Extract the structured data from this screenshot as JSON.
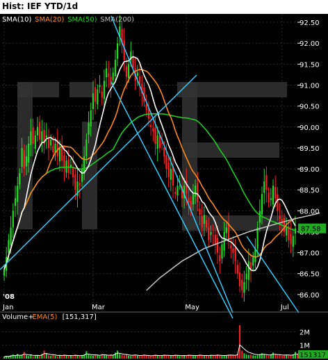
{
  "title": "Hist: IEF YTD/1d",
  "chart_data": [
    {
      "type": "candlestick",
      "legend": [
        {
          "label": "SMA(10)",
          "color": "#ffffff"
        },
        {
          "label": "SMA(20)",
          "color": "#ff8a1e"
        },
        {
          "label": "SMA(50)",
          "color": "#22cc22"
        },
        {
          "label": "SMA(200)",
          "color": "#c0c0c0"
        }
      ],
      "ylim": [
        85.6,
        92.7
      ],
      "yticks": [
        92.5,
        92.0,
        91.5,
        91.0,
        90.5,
        90.0,
        89.5,
        89.0,
        88.5,
        88.0,
        87.5,
        87.0,
        86.5,
        86.0
      ],
      "ytick_labels": [
        "92.50",
        "92.00",
        "91.50",
        "91.00",
        "90.50",
        "90.00",
        "89.50",
        "89.00",
        "88.50",
        "88.00",
        "87.50",
        "87.00",
        "86.50",
        "86.00"
      ],
      "xticks": [
        {
          "day": 0,
          "label": "Jan"
        },
        {
          "day": 40,
          "label": "Mar"
        },
        {
          "day": 82,
          "label": "May"
        },
        {
          "day": 125,
          "label": "Jul"
        }
      ],
      "year_label": "'08",
      "last_price": "87.58",
      "up_color": "#22dd22",
      "down_color": "#ff2020",
      "sma10_color": "#ffffff",
      "sma20_color": "#ff8a1e",
      "sma50_color": "#22cc22",
      "sma200_color": "#c0c0c0",
      "trendline_color": "#33ccff",
      "closes": [
        86.6,
        86.9,
        87.3,
        87.6,
        88.0,
        88.3,
        88.6,
        88.9,
        89.5,
        89.0,
        89.3,
        89.6,
        89.9,
        89.6,
        89.8,
        90.0,
        89.7,
        89.9,
        89.6,
        89.8,
        89.5,
        89.7,
        89.4,
        89.6,
        89.3,
        89.5,
        89.2,
        89.0,
        89.2,
        88.9,
        89.1,
        88.8,
        88.5,
        88.7,
        88.6,
        89.0,
        89.3,
        89.7,
        90.1,
        90.4,
        90.8,
        90.6,
        90.9,
        91.0,
        90.7,
        91.1,
        91.4,
        91.2,
        91.0,
        91.3,
        91.6,
        92.0,
        92.4,
        92.0,
        91.6,
        91.2,
        91.5,
        91.8,
        91.4,
        91.1,
        91.3,
        91.0,
        90.8,
        90.6,
        90.4,
        90.2,
        90.0,
        89.9,
        89.6,
        89.8,
        89.5,
        89.6,
        89.3,
        89.0,
        88.8,
        89.0,
        88.6,
        88.4,
        88.6,
        88.7,
        88.3,
        88.6,
        88.4,
        88.2,
        88.0,
        88.4,
        88.6,
        88.2,
        87.9,
        87.6,
        87.9,
        87.6,
        87.3,
        87.5,
        87.4,
        87.2,
        87.0,
        86.8,
        87.2,
        87.5,
        87.6,
        87.3,
        87.1,
        87.0,
        86.8,
        86.5,
        86.2,
        86.1,
        86.3,
        86.5,
        86.8,
        86.6,
        86.9,
        87.1,
        87.6,
        88.0,
        88.4,
        88.7,
        88.5,
        88.2,
        88.3,
        88.6,
        88.3,
        88.0,
        87.8,
        87.7,
        87.5,
        87.6,
        87.3,
        87.2,
        87.4,
        87.58
      ],
      "sma200": [
        [
          64,
          86.1
        ],
        [
          70,
          86.4
        ],
        [
          80,
          86.8
        ],
        [
          90,
          87.1
        ],
        [
          100,
          87.3
        ],
        [
          110,
          87.5
        ],
        [
          120,
          87.65
        ],
        [
          130,
          87.8
        ],
        [
          140,
          87.92
        ],
        [
          142,
          87.95
        ]
      ],
      "volume": {
        "label": "Volume",
        "ema_label": "EMA(5)",
        "value_label": "[151,317]",
        "last_label": "151317",
        "ylim": [
          0,
          2.7
        ],
        "yticks": [
          {
            "v": 2,
            "label": "2M"
          },
          {
            "v": 1,
            "label": "1M"
          }
        ],
        "bars": [
          0.15,
          0.2,
          0.18,
          0.25,
          0.3,
          0.2,
          0.35,
          0.22,
          0.28,
          0.5,
          0.25,
          0.2,
          0.3,
          0.18,
          0.22,
          0.25,
          0.2,
          0.35,
          0.6,
          0.4,
          0.25,
          0.2,
          0.3,
          0.22,
          0.18,
          0.25,
          0.2,
          0.3,
          0.22,
          0.2,
          0.25,
          0.18,
          0.3,
          0.22,
          0.2,
          0.25,
          0.3,
          0.55,
          0.3,
          0.25,
          0.22,
          0.3,
          0.25,
          0.2,
          0.35,
          0.3,
          0.25,
          0.2,
          0.3,
          0.25,
          0.45,
          0.6,
          0.35,
          0.28,
          0.25,
          0.3,
          0.22,
          0.2,
          0.25,
          0.3,
          0.22,
          0.2,
          0.25,
          0.3,
          0.22,
          0.2,
          0.18,
          0.25,
          0.3,
          0.22,
          0.2,
          0.25,
          0.3,
          0.22,
          0.25,
          0.2,
          0.22,
          0.3,
          0.25,
          0.2,
          0.22,
          0.25,
          0.2,
          0.3,
          0.25,
          0.22,
          0.2,
          0.25,
          0.3,
          0.22,
          0.2,
          0.25,
          0.2,
          0.28,
          0.25,
          0.22,
          0.3,
          0.25,
          0.2,
          0.22,
          0.25,
          0.3,
          0.28,
          0.25,
          0.22,
          0.35,
          2.5,
          0.6,
          0.4,
          0.3,
          0.28,
          0.3,
          0.25,
          0.22,
          0.25,
          0.3,
          0.4,
          0.3,
          0.25,
          0.22,
          0.3,
          0.45,
          0.3,
          0.25,
          0.3,
          0.22,
          0.25,
          0.3,
          0.25,
          0.22,
          0.3,
          0.5,
          0.3,
          0.25,
          0.22,
          0.3,
          0.25,
          0.22,
          0.2,
          0.25,
          0.25,
          0.2,
          0.3,
          0.15
        ]
      }
    }
  ]
}
